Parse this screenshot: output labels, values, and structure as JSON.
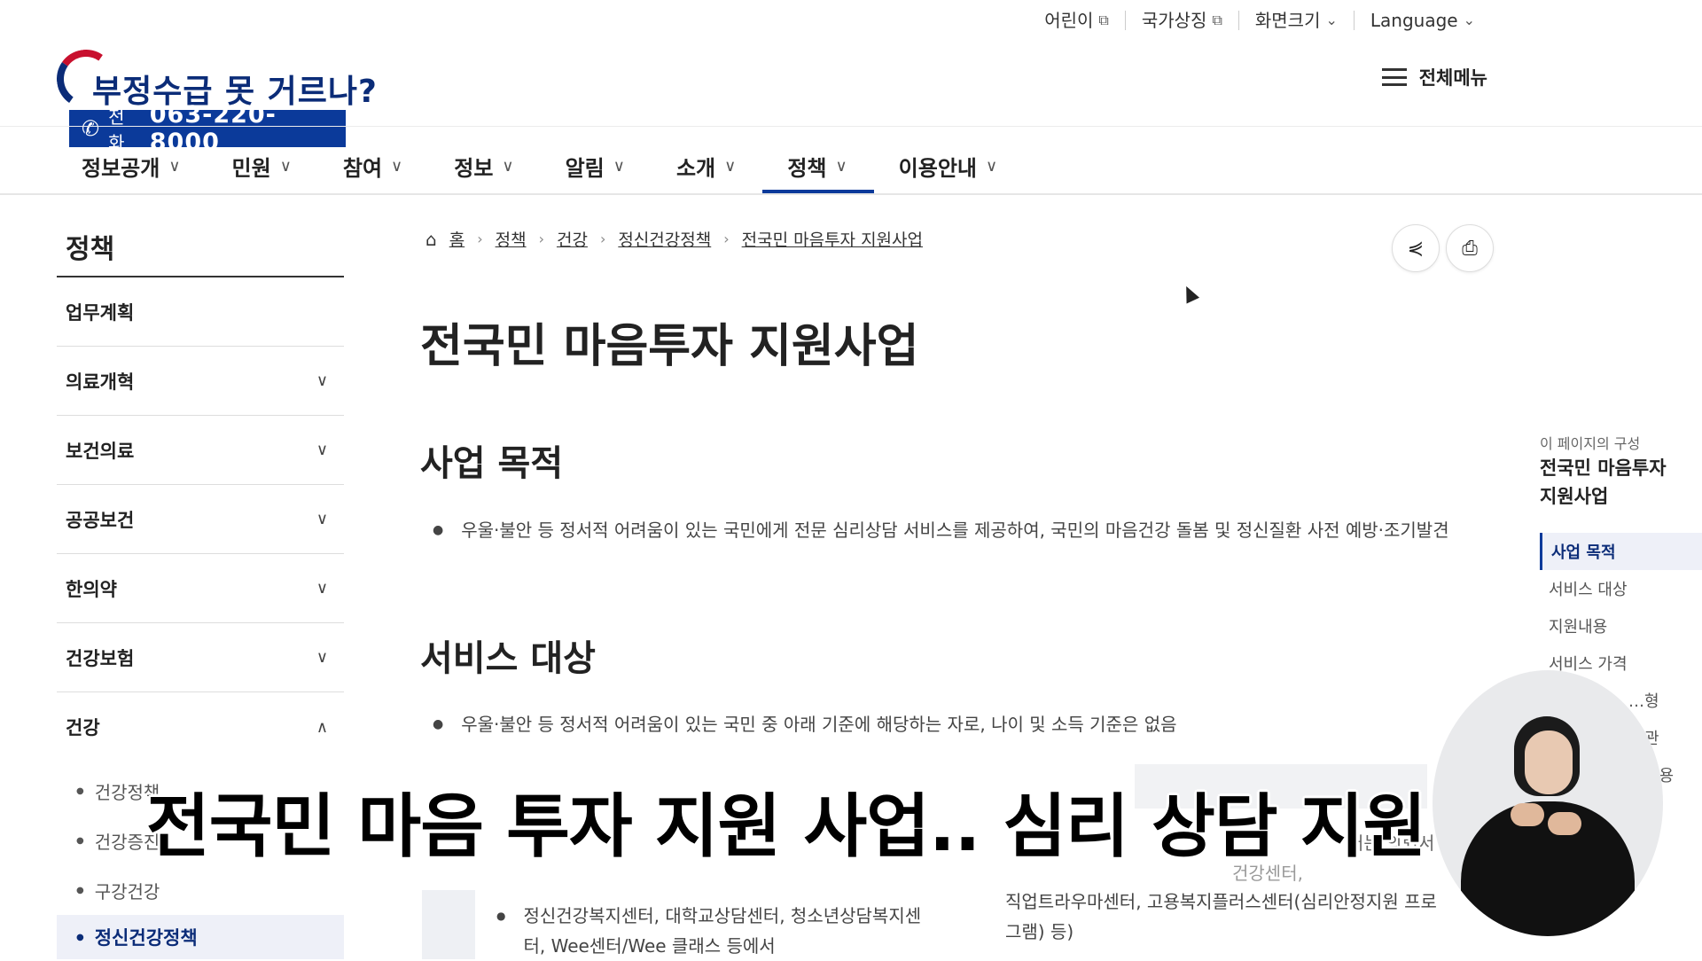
{
  "utility": {
    "items": [
      {
        "label": "어린이",
        "icon": "external-link-icon"
      },
      {
        "label": "국가상징",
        "icon": "external-link-icon"
      },
      {
        "label": "화면크기",
        "icon": "chevron-down-icon"
      },
      {
        "label": "Language",
        "icon": "chevron-down-icon"
      }
    ]
  },
  "logo": {
    "slogan": "부정수급 못 거르나?",
    "phone_label": "전화",
    "phone_number": "063-220-8000"
  },
  "all_menu": {
    "label": "전체메뉴"
  },
  "gnb": {
    "items": [
      {
        "label": "정보공개"
      },
      {
        "label": "민원"
      },
      {
        "label": "참여"
      },
      {
        "label": "정보"
      },
      {
        "label": "알림"
      },
      {
        "label": "소개"
      },
      {
        "label": "정책"
      },
      {
        "label": "이용안내"
      }
    ],
    "active_index": 6
  },
  "sidebar": {
    "title": "정책",
    "items": [
      {
        "label": "업무계획",
        "expandable": false
      },
      {
        "label": "의료개혁",
        "expandable": true
      },
      {
        "label": "보건의료",
        "expandable": true
      },
      {
        "label": "공공보건",
        "expandable": true
      },
      {
        "label": "한의약",
        "expandable": true
      },
      {
        "label": "건강보험",
        "expandable": true
      },
      {
        "label": "건강",
        "expandable": true,
        "expanded": true
      }
    ],
    "sub_items": [
      {
        "label": "건강정책"
      },
      {
        "label": "건강증진"
      },
      {
        "label": "구강건강"
      },
      {
        "label": "정신건강정책",
        "active": true
      }
    ]
  },
  "breadcrumb": {
    "items": [
      "홈",
      "정책",
      "건강",
      "정신건강정책",
      "전국민 마음투자 지원사업"
    ]
  },
  "actions": {
    "share_icon": "share-icon",
    "print_icon": "printer-icon"
  },
  "main": {
    "title": "전국민 마음투자 지원사업",
    "sections": [
      {
        "heading": "사업 목적",
        "text": "우울·불안 등 정서적 어려움이 있는 국민에게 전문 심리상담 서비스를 제공하여, 국민의 마음건강 돌봄 및 정신질환 사전 예방·조기발견"
      },
      {
        "heading": "서비스 대상",
        "text": "우울·불안 등 정서적 어려움이 있는 국민 중 아래 기준에 해당하는 자로, 나이 및 소득 기준은 없음"
      }
    ],
    "partial_text_right": "터는 의뢰서",
    "partial_text_right2": "건강센터,",
    "list_left": "정신건강복지센터, 대학교상담센터, 청소년상담복지센터, Wee센터/Wee 클래스 등에서",
    "list_right": "직업트라우마센터, 고용복지플러스센터(심리안정지원 프로그램) 등)"
  },
  "toc": {
    "label": "이 페이지의 구성",
    "title": "전국민 마음투자 지원사업",
    "items": [
      {
        "label": "사업 목적",
        "active": true
      },
      {
        "label": "서비스 대상"
      },
      {
        "label": "지원내용"
      },
      {
        "label": "서비스 가격"
      },
      {
        "label": "…형"
      },
      {
        "label": "…관"
      },
      {
        "label": "…이용"
      }
    ]
  },
  "caption": {
    "text": "전국민 마음 투자 지원 사업.. 심리 상담 지원"
  },
  "colors": {
    "brand_blue": "#0b3a9a",
    "brand_red": "#c8102e",
    "active_bg": "#eef0f8"
  }
}
